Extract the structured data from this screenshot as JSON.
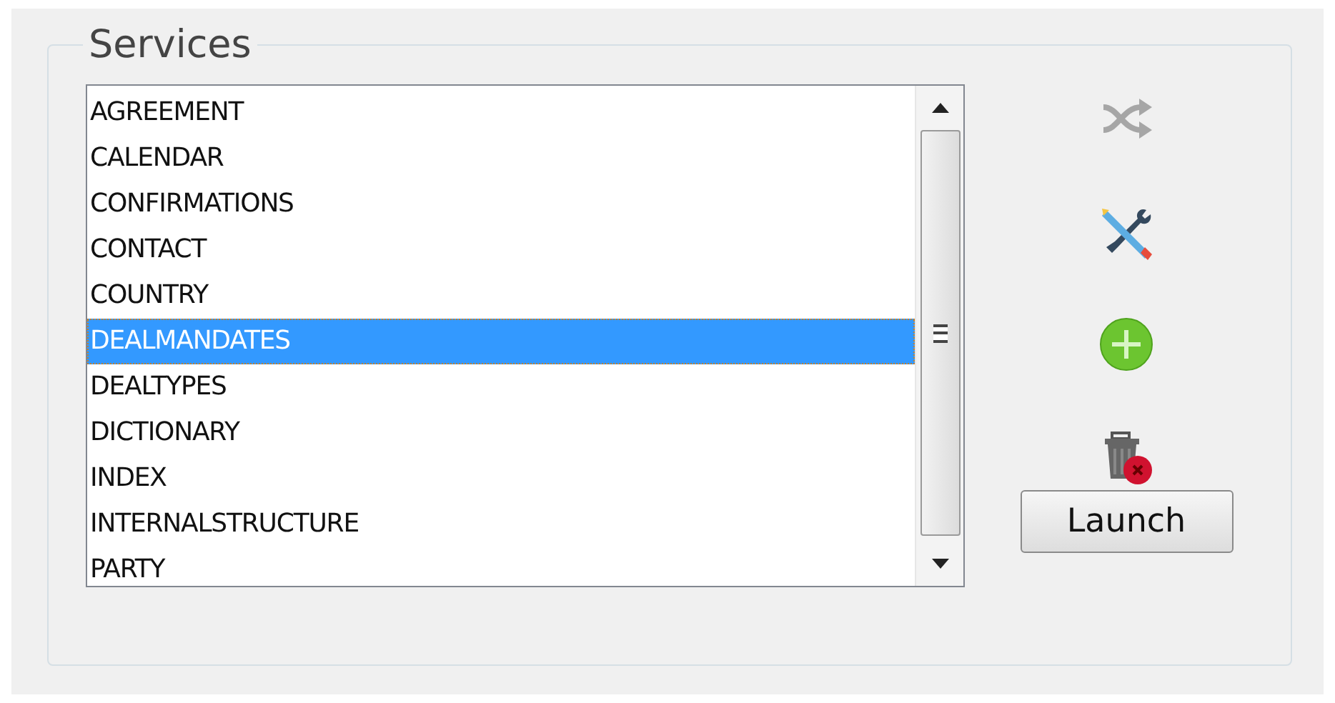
{
  "group": {
    "title": "Services"
  },
  "list": {
    "items": [
      {
        "label": "AGREEMENT",
        "selected": false
      },
      {
        "label": "CALENDAR",
        "selected": false
      },
      {
        "label": "CONFIRMATIONS",
        "selected": false
      },
      {
        "label": "CONTACT",
        "selected": false
      },
      {
        "label": "COUNTRY",
        "selected": false
      },
      {
        "label": "DEALMANDATES",
        "selected": true
      },
      {
        "label": "DEALTYPES",
        "selected": false
      },
      {
        "label": "DICTIONARY",
        "selected": false
      },
      {
        "label": "INDEX",
        "selected": false
      },
      {
        "label": "INTERNALSTRUCTURE",
        "selected": false
      },
      {
        "label": "PARTY",
        "selected": false
      }
    ]
  },
  "tools": [
    {
      "kind": "shuffle",
      "disabled": true
    },
    {
      "kind": "edit",
      "disabled": false
    },
    {
      "kind": "add",
      "disabled": false
    },
    {
      "kind": "delete",
      "disabled": false
    }
  ],
  "buttons": [
    "Launch"
  ]
}
